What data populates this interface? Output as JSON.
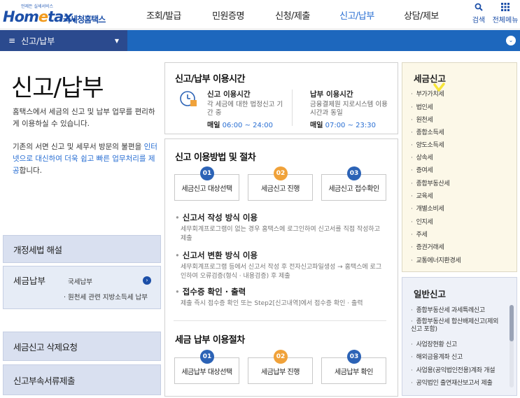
{
  "header": {
    "logo_tagline": "언제든 실세서비스",
    "logo_brand_a": "Hom",
    "logo_brand_e": "e",
    "logo_brand_b": "tax.",
    "logo_korean": "국세청홈택스",
    "nav": [
      "조회/발급",
      "민원증명",
      "신청/제출",
      "신고/납부",
      "상담/제보"
    ],
    "search_label": "검색",
    "allmenu_label": "전체메뉴"
  },
  "navbar": {
    "menu_label": "신고/납부"
  },
  "left": {
    "title": "신고/납부",
    "intro_1": "홈택스에서 세금의 신고 및 납부 업무를 편리하게 이용하실 수 있습니다.",
    "intro_2a": "기존의 서면 신고 및 세무서 방문의 불편을",
    "intro_2b": "인터넷으로 대신하여 더욱 쉽고 빠른 업무처리를 제공",
    "intro_2c": "합니다.",
    "btn_tax_law": "개정세법 해설",
    "btn_tax_pay": "세금납부",
    "pay_sub1": "국세납부",
    "pay_sub2": "· 원천세 관련 지방소득세 납부",
    "btn_delete": "세금신고 삭제요청",
    "btn_docs": "신고부속서류제출"
  },
  "hours": {
    "title": "신고/납부 이용시간",
    "report_label": "신고 이용시간",
    "report_desc": "각 세금에 대한 법정신고 기간 중",
    "report_daily": "매일",
    "report_time": "06:00 ~ 24:00",
    "pay_label": "납부 이용시간",
    "pay_desc": "금융결제원 지로시스템 이용시간과 동일",
    "pay_daily": "매일",
    "pay_time": "07:00 ~ 23:30"
  },
  "procedure": {
    "title": "신고 이용방법 및 절차",
    "steps": [
      {
        "num": "01",
        "label": "세금신고 대상선택"
      },
      {
        "num": "02",
        "label": "세금신고 진행"
      },
      {
        "num": "03",
        "label": "세금신고 접수확인"
      }
    ],
    "methods": [
      {
        "title": "신고서 작성 방식 이용",
        "desc": "세무회계프로그램이 없는 경우 홈택스에 로그인하여 신고서를 직접 작성하고 제출"
      },
      {
        "title": "신고서 변환 방식 이용",
        "desc": "세무회계프로그램 등에서 신고서 작성 후 전자신고파일생성 → 홈택스에 로그인하여 오류검증(형식 · 내용검증) 후 제출"
      },
      {
        "title": "접수증 확인 · 출력",
        "desc": "제출 즉시 접수증 확인 또는 Step2[신고내역]에서 접수증 확인 · 출력"
      }
    ],
    "pay_title": "세금 납부 이용절차",
    "pay_steps": [
      {
        "num": "01",
        "label": "세금납부 대상선택"
      },
      {
        "num": "02",
        "label": "세금납부 진행"
      },
      {
        "num": "03",
        "label": "세금납부 확인"
      }
    ]
  },
  "tax_report": {
    "title": "세금신고",
    "items": [
      "부가가치세",
      "법인세",
      "원천세",
      "종합소득세",
      "양도소득세",
      "상속세",
      "증여세",
      "종합부동산세",
      "교육세",
      "개별소비세",
      "인지세",
      "주세",
      "증권거래세",
      "교통에너지환경세"
    ]
  },
  "general_report": {
    "title": "일반신고",
    "items": [
      "종합부동산세 과세특례신고",
      "종합부동산세 합산배제신고(제외신고 포함)",
      "사업장현황 신고",
      "해외금융계좌 신고",
      "사업용(공익법인전용)계좌 개설",
      "공익법인 출연재산보고서 제출"
    ]
  },
  "colors": {
    "brand": "#1c4fa8",
    "active": "#2a6fd3",
    "bar": "#1d67bd",
    "orange": "#f0a23a"
  }
}
